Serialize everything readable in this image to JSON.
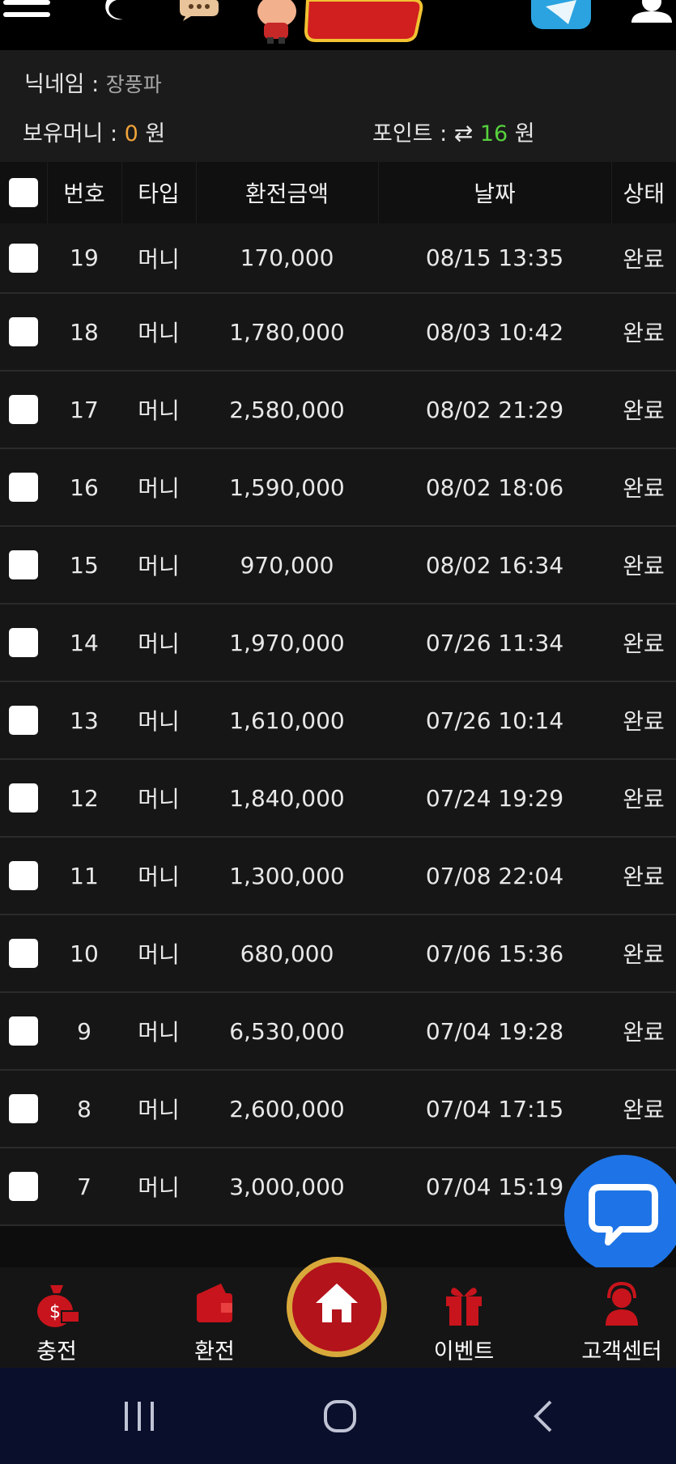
{
  "header": {
    "menu_icon": "hamburger-icon",
    "theme_icon": "moon-icon",
    "chat_icon": "speech-bubble-icon",
    "logo_icon": "mascot-logo",
    "telegram_icon": "telegram-icon",
    "user_icon": "user-icon"
  },
  "info": {
    "nickname_label": "닉네임 : ",
    "nickname_value": "장풍파",
    "money_label": "보유머니 : ",
    "money_value": "0",
    "money_unit": " 원",
    "points_label": "포인트 : ",
    "points_icon": "⇄",
    "points_value": "16",
    "points_unit": " 원"
  },
  "table": {
    "headers": [
      "번호",
      "타입",
      "환전금액",
      "날짜",
      "상태"
    ],
    "rows": [
      {
        "no": "19",
        "type": "머니",
        "amount": "170,000",
        "date": "08/15 13:35",
        "status": "완료"
      },
      {
        "no": "18",
        "type": "머니",
        "amount": "1,780,000",
        "date": "08/03 10:42",
        "status": "완료"
      },
      {
        "no": "17",
        "type": "머니",
        "amount": "2,580,000",
        "date": "08/02 21:29",
        "status": "완료"
      },
      {
        "no": "16",
        "type": "머니",
        "amount": "1,590,000",
        "date": "08/02 18:06",
        "status": "완료"
      },
      {
        "no": "15",
        "type": "머니",
        "amount": "970,000",
        "date": "08/02 16:34",
        "status": "완료"
      },
      {
        "no": "14",
        "type": "머니",
        "amount": "1,970,000",
        "date": "07/26 11:34",
        "status": "완료"
      },
      {
        "no": "13",
        "type": "머니",
        "amount": "1,610,000",
        "date": "07/26 10:14",
        "status": "완료"
      },
      {
        "no": "12",
        "type": "머니",
        "amount": "1,840,000",
        "date": "07/24 19:29",
        "status": "완료"
      },
      {
        "no": "11",
        "type": "머니",
        "amount": "1,300,000",
        "date": "07/08 22:04",
        "status": "완료"
      },
      {
        "no": "10",
        "type": "머니",
        "amount": "680,000",
        "date": "07/06 15:36",
        "status": "완료"
      },
      {
        "no": "9",
        "type": "머니",
        "amount": "6,530,000",
        "date": "07/04 19:28",
        "status": "완료"
      },
      {
        "no": "8",
        "type": "머니",
        "amount": "2,600,000",
        "date": "07/04 17:15",
        "status": "완료"
      },
      {
        "no": "7",
        "type": "머니",
        "amount": "3,000,000",
        "date": "07/04 15:19",
        "status": ""
      }
    ]
  },
  "chat_fab_icon": "chat-bubble-icon",
  "bottom_nav": {
    "charge": "충전",
    "exchange": "환전",
    "home_icon": "home-icon",
    "event": "이벤트",
    "support": "고객센터"
  },
  "system_nav": {
    "recents_icon": "recents-icon",
    "home_icon": "circle-home-icon",
    "back_icon": "back-icon"
  },
  "colors": {
    "money_accent": "#f0a23a",
    "points_accent": "#57d13e",
    "nav_icon_red": "#c8141c",
    "chat_fab_blue": "#1e74e6",
    "home_gold": "#d8a93a"
  }
}
